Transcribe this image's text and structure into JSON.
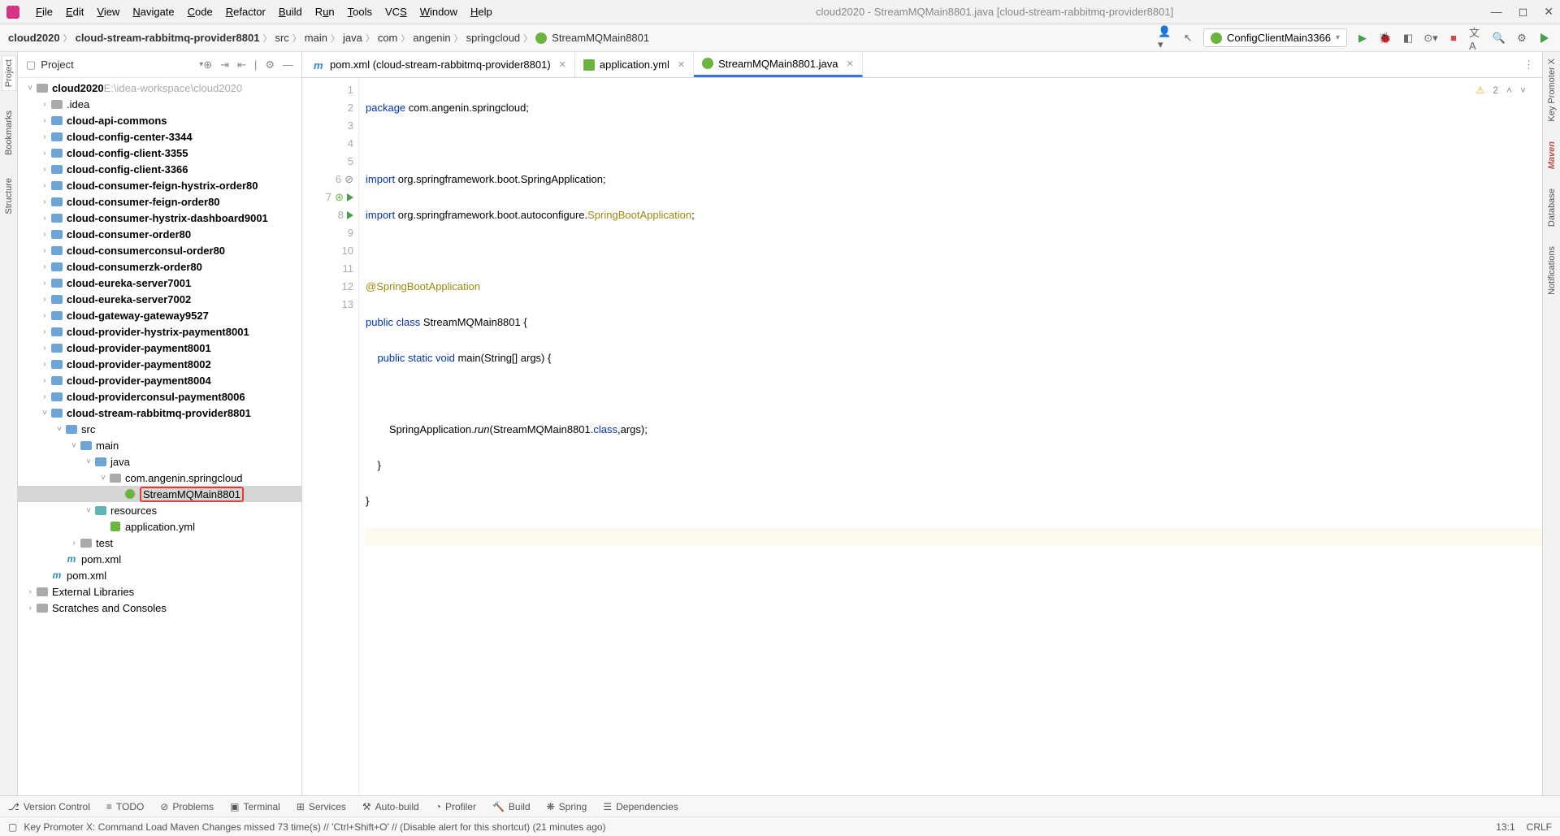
{
  "window": {
    "title": "cloud2020 - StreamMQMain8801.java [cloud-stream-rabbitmq-provider8801]"
  },
  "menu": [
    "File",
    "Edit",
    "View",
    "Navigate",
    "Code",
    "Refactor",
    "Build",
    "Run",
    "Tools",
    "VCS",
    "Window",
    "Help"
  ],
  "breadcrumb": [
    "cloud2020",
    "cloud-stream-rabbitmq-provider8801",
    "src",
    "main",
    "java",
    "com",
    "angenin",
    "springcloud",
    "StreamMQMain8801"
  ],
  "runconfig": "ConfigClientMain3366",
  "sidebar": {
    "title": "Project"
  },
  "tree": {
    "root": "cloud2020",
    "rootPath": "E:\\idea-workspace\\cloud2020",
    "items": [
      ".idea",
      "cloud-api-commons",
      "cloud-config-center-3344",
      "cloud-config-client-3355",
      "cloud-config-client-3366",
      "cloud-consumer-feign-hystrix-order80",
      "cloud-consumer-feign-order80",
      "cloud-consumer-hystrix-dashboard9001",
      "cloud-consumer-order80",
      "cloud-consumerconsul-order80",
      "cloud-consumerzk-order80",
      "cloud-eureka-server7001",
      "cloud-eureka-server7002",
      "cloud-gateway-gateway9527",
      "cloud-provider-hystrix-payment8001",
      "cloud-provider-payment8001",
      "cloud-provider-payment8002",
      "cloud-provider-payment8004",
      "cloud-providerconsul-payment8006",
      "cloud-stream-rabbitmq-provider8801"
    ],
    "sub": {
      "src": "src",
      "main": "main",
      "java": "java",
      "pkg": "com.angenin.springcloud",
      "cls": "StreamMQMain8801",
      "res": "resources",
      "yml": "application.yml",
      "test": "test",
      "pom": "pom.xml",
      "pomroot": "pom.xml",
      "ext": "External Libraries",
      "scratch": "Scratches and Consoles"
    }
  },
  "tabs": [
    {
      "label": "pom.xml (cloud-stream-rabbitmq-provider8801)",
      "type": "m"
    },
    {
      "label": "application.yml",
      "type": "yml"
    },
    {
      "label": "StreamMQMain8801.java",
      "type": "java"
    }
  ],
  "code": {
    "l1a": "package",
    "l1b": " com.angenin.springcloud;",
    "l3a": "import",
    "l3b": " org.springframework.boot.SpringApplication;",
    "l4a": "import",
    "l4b": " org.springframework.boot.autoconfigure.",
    "l4c": "SpringBootApplication",
    "l4d": ";",
    "l6": "@SpringBootApplication",
    "l7a": "public class ",
    "l7b": "StreamMQMain8801",
    "l7c": " {",
    "l8a": "    public static void ",
    "l8b": "main",
    "l8c": "(String[] args) {",
    "l10a": "        SpringApplication.",
    "l10b": "run",
    "l10c": "(StreamMQMain8801.",
    "l10d": "class",
    "l10e": ",args);",
    "l11": "    }",
    "l12": "}"
  },
  "warnings": "2",
  "leftTabs": [
    "Project",
    "Bookmarks",
    "Structure"
  ],
  "rightTabs": [
    "Key Promoter X",
    "Maven",
    "Database",
    "Notifications"
  ],
  "bottom": [
    "Version Control",
    "TODO",
    "Problems",
    "Terminal",
    "Services",
    "Auto-build",
    "Profiler",
    "Build",
    "Spring",
    "Dependencies"
  ],
  "status": {
    "msg": "Key Promoter X: Command Load Maven Changes missed 73 time(s) // 'Ctrl+Shift+O' // (Disable alert for this shortcut) (21 minutes ago)",
    "pos": "13:1",
    "enc": "CRLF"
  }
}
